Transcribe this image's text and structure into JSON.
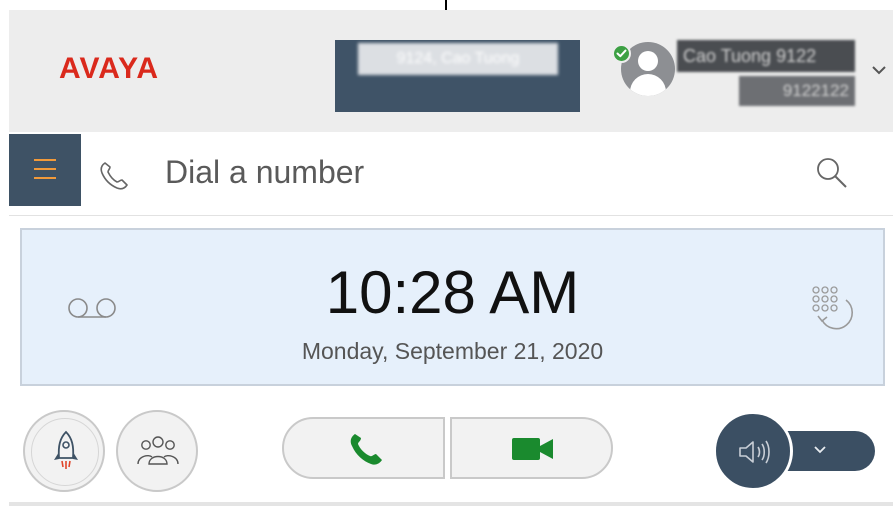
{
  "header": {
    "logo_text": "AVAYA",
    "extension_label": "9124, Cao Tuong",
    "user_name": "Cao Tuong 9122",
    "user_extension": "9122122",
    "presence_status": "available",
    "avatar_icon": "person-icon",
    "menu_icon": "chevron-down-icon"
  },
  "dial_bar": {
    "menu_icon": "hamburger-icon",
    "phone_icon": "phone-outline-icon",
    "placeholder": "Dial a number",
    "search_icon": "search-icon"
  },
  "clock": {
    "time": "10:28 AM",
    "date": "Monday, September 21, 2020",
    "voicemail_icon": "voicemail-icon",
    "redial_icon": "redial-keypad-icon"
  },
  "actions": {
    "buttons": [
      {
        "name": "quick-launch",
        "icon": "rocket-icon"
      },
      {
        "name": "contacts",
        "icon": "group-icon"
      },
      {
        "name": "audio-call",
        "icon": "phone-icon"
      },
      {
        "name": "video-call",
        "icon": "video-camera-icon"
      },
      {
        "name": "audio-device",
        "icon": "speaker-icon"
      },
      {
        "name": "audio-device-menu",
        "icon": "chevron-down-icon"
      }
    ]
  },
  "colors": {
    "brand_red": "#da291c",
    "header_bg": "#ededed",
    "dark_slate": "#3e5265",
    "accent_orange": "#f29a3a",
    "call_green": "#1a8a2e",
    "presence_green": "#3ca043",
    "clock_panel_bg": "#e6f0fb"
  }
}
